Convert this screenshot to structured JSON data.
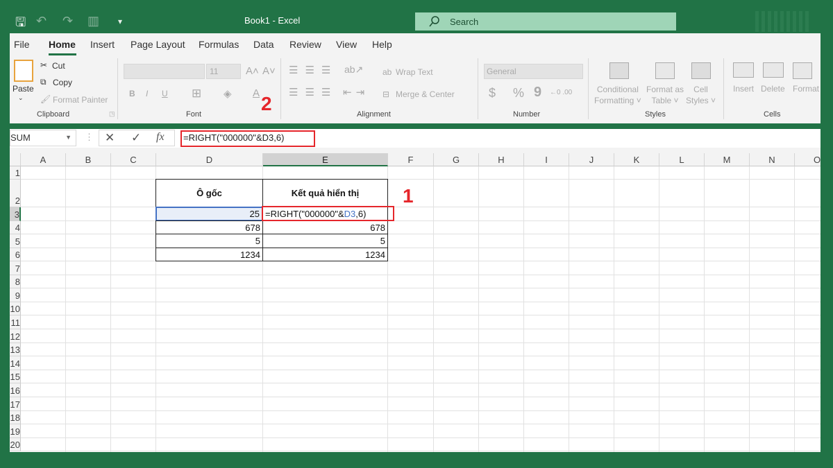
{
  "titlebar": {
    "title": "Book1  -  Excel",
    "search_placeholder": "Search"
  },
  "tabs": [
    "File",
    "Home",
    "Insert",
    "Page Layout",
    "Formulas",
    "Data",
    "Review",
    "View",
    "Help"
  ],
  "clipboard": {
    "paste": "Paste",
    "cut": "Cut",
    "copy": "Copy",
    "format_painter": "Format Painter",
    "group": "Clipboard"
  },
  "font": {
    "size": "11",
    "bold": "B",
    "italic": "I",
    "underline": "U",
    "group": "Font"
  },
  "alignment": {
    "wrap": "Wrap Text",
    "merge": "Merge & Center",
    "group": "Alignment"
  },
  "number": {
    "format": "General",
    "currency": "$",
    "percent": "%",
    "comma": "9",
    "group": "Number"
  },
  "styles": {
    "conditional1": "Conditional",
    "conditional2": "Formatting",
    "table1": "Format as",
    "table2": "Table",
    "cell1": "Cell",
    "cell2": "Styles",
    "group": "Styles"
  },
  "cells": {
    "insert": "Insert",
    "delete": "Delete",
    "format": "Format",
    "group": "Cells"
  },
  "formula_bar": {
    "name_box": "SUM",
    "cancel": "✕",
    "enter": "✓",
    "fx": "fx",
    "formula": "=RIGHT(\"000000\"&D3,6)"
  },
  "annotations": {
    "one": "1",
    "two": "2"
  },
  "columns": [
    "A",
    "B",
    "C",
    "D",
    "E",
    "F",
    "G",
    "H",
    "I",
    "J",
    "K",
    "L",
    "M",
    "N",
    "O"
  ],
  "rows": [
    "1",
    "2",
    "3",
    "4",
    "5",
    "6",
    "7",
    "8",
    "9",
    "10",
    "11",
    "12",
    "13",
    "14",
    "15",
    "16",
    "17",
    "18",
    "19",
    "20"
  ],
  "table": {
    "headers": [
      "Ô gốc",
      "Kết quả hiển thị"
    ],
    "rows": [
      [
        "25",
        "=RIGHT(\"000000\"&D3,6)"
      ],
      [
        "678",
        "678"
      ],
      [
        "5",
        "5"
      ],
      [
        "1234",
        "1234"
      ]
    ],
    "edit_formula_parts": [
      "=RIGHT(\"000000\"&",
      "D3",
      ",6)"
    ]
  },
  "colors": {
    "accent": "#217346",
    "reference": "#4472c4",
    "annotation": "#e5262b"
  }
}
